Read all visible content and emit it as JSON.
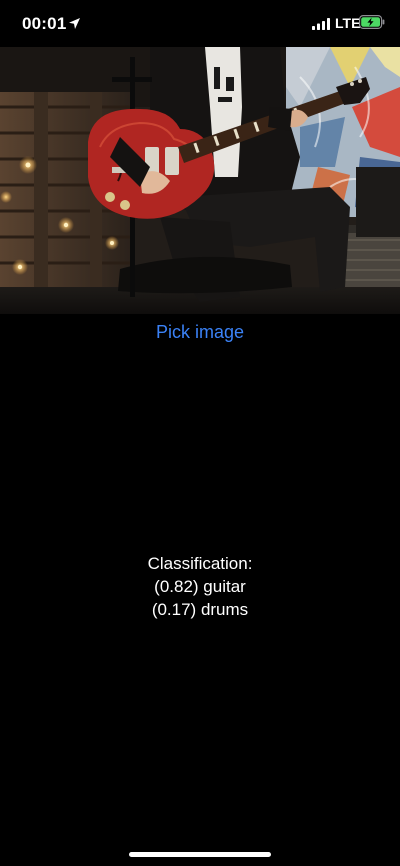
{
  "status_bar": {
    "time": "00:01",
    "network": "LTE",
    "location_icon": "location-arrow-icon",
    "signal_icon": "cellular-signal-icon",
    "battery_icon": "battery-charging-icon",
    "battery_color": "#4cd964"
  },
  "photo": {
    "subject": "guitar-player-photo"
  },
  "pick_button": {
    "label": "Pick image",
    "color": "#3b82f6"
  },
  "classification": {
    "heading": "Classification:",
    "results": [
      {
        "text": "(0.82) guitar"
      },
      {
        "text": "(0.17) drums"
      }
    ]
  }
}
